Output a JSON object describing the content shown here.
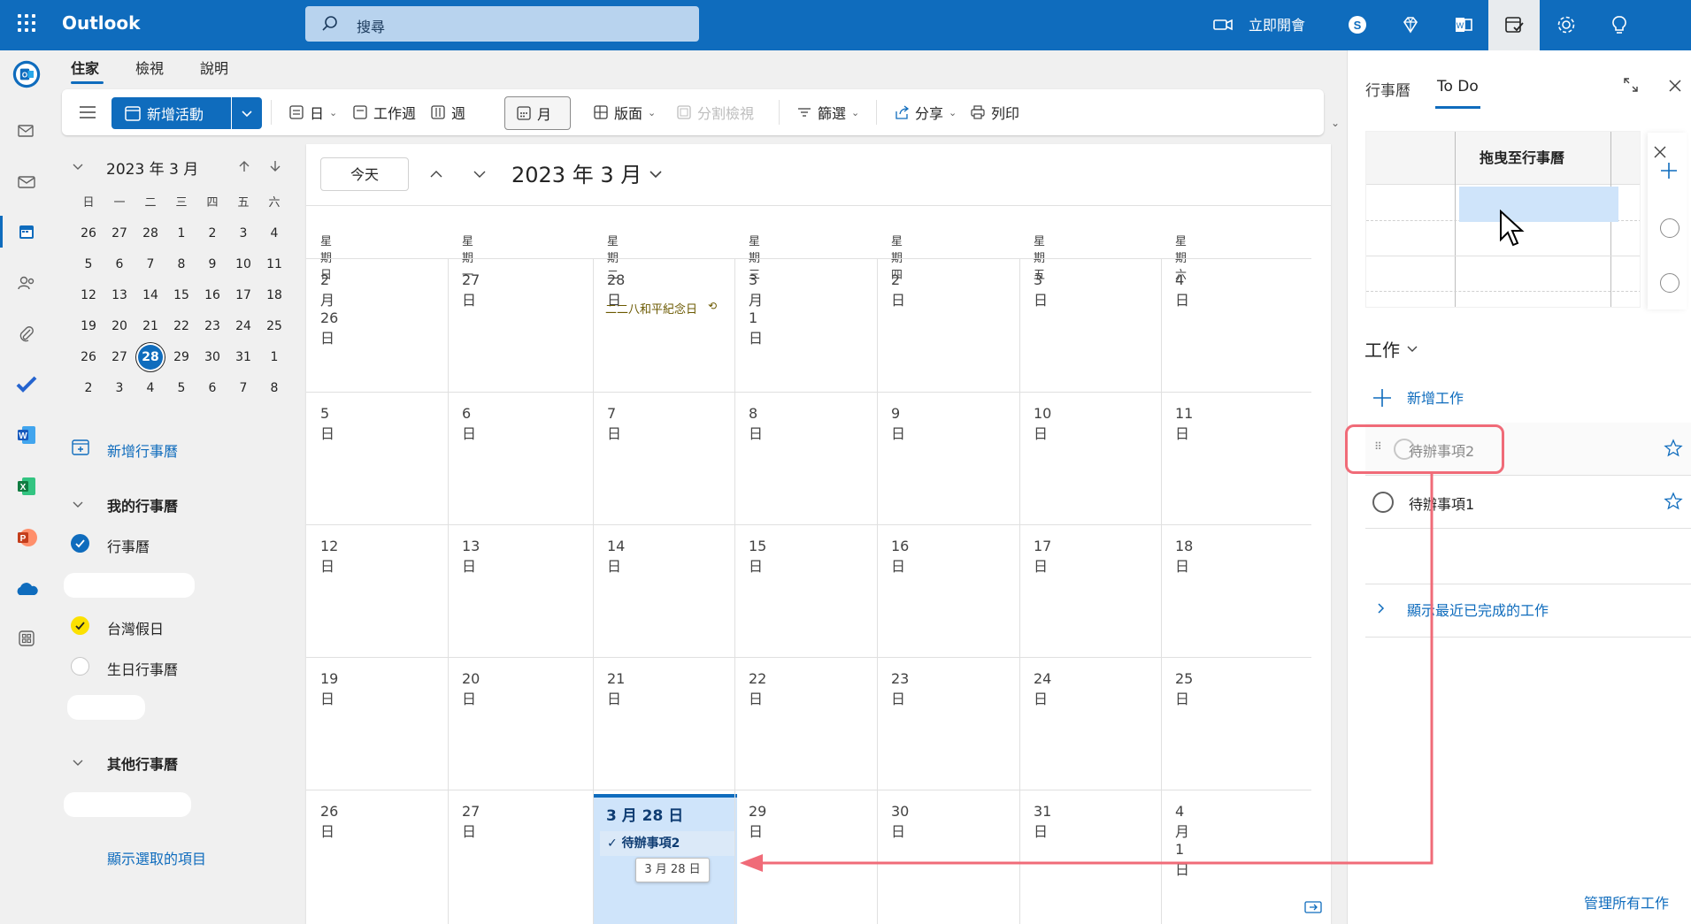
{
  "app": {
    "name": "Outlook"
  },
  "search": {
    "placeholder": "搜尋"
  },
  "topbar": {
    "meet_now": "立即開會"
  },
  "menu_tabs": [
    "住家",
    "檢視",
    "說明"
  ],
  "ribbon": {
    "new_event": "新增活動",
    "day": "日",
    "work_week": "工作週",
    "week": "週",
    "month": "月",
    "layout": "版面",
    "split_view": "分割檢視",
    "filter": "篩選",
    "share": "分享",
    "print": "列印"
  },
  "mini_calendar": {
    "title": "2023 年 3 月",
    "weekdays": [
      "日",
      "一",
      "二",
      "三",
      "四",
      "五",
      "六"
    ],
    "weeks": [
      [
        "26",
        "27",
        "28",
        "1",
        "2",
        "3",
        "4"
      ],
      [
        "5",
        "6",
        "7",
        "8",
        "9",
        "10",
        "11"
      ],
      [
        "12",
        "13",
        "14",
        "15",
        "16",
        "17",
        "18"
      ],
      [
        "19",
        "20",
        "21",
        "22",
        "23",
        "24",
        "25"
      ],
      [
        "26",
        "27",
        "28",
        "29",
        "30",
        "31",
        "1"
      ],
      [
        "2",
        "3",
        "4",
        "5",
        "6",
        "7",
        "8"
      ]
    ],
    "today": "28"
  },
  "left_panel": {
    "add_calendar": "新增行事曆",
    "my_calendars": "我的行事曆",
    "calendars": [
      {
        "name": "行事曆",
        "color": "#0f6cbd"
      },
      {
        "name": "台灣假日",
        "color": "#fce100"
      },
      {
        "name": "生日行事曆",
        "color": ""
      }
    ],
    "other_calendars": "其他行事曆",
    "show_selected": "顯示選取的項目"
  },
  "calendar": {
    "today_button": "今天",
    "title": "2023 年 3 月",
    "weekdays": [
      "星期日",
      "星期一",
      "星期二",
      "星期三",
      "星期四",
      "星期五",
      "星期六"
    ],
    "weeks": [
      [
        "2 月 26 日",
        "27 日",
        "28 日",
        "3 月 1 日",
        "2 日",
        "3 日",
        "4 日"
      ],
      [
        "5 日",
        "6 日",
        "7 日",
        "8 日",
        "9 日",
        "10 日",
        "11 日"
      ],
      [
        "12 日",
        "13 日",
        "14 日",
        "15 日",
        "16 日",
        "17 日",
        "18 日"
      ],
      [
        "19 日",
        "20 日",
        "21 日",
        "22 日",
        "23 日",
        "24 日",
        "25 日"
      ],
      [
        "26 日",
        "27 日",
        "3 月 28 日",
        "29 日",
        "30 日",
        "31 日",
        "4 月 1 日"
      ]
    ],
    "holiday_event": "二二八和平紀念日",
    "dropped_event": "待辦事項2",
    "drag_tooltip": "3 月 28 日"
  },
  "right_pane": {
    "tabs": [
      "行事曆",
      "To Do"
    ],
    "drag_hint": "拖曳至行事曆",
    "tasks_title": "工作",
    "add_task": "新增工作",
    "tasks": [
      {
        "title": "待辦事項2",
        "dragging": true
      },
      {
        "title": "待辦事項1",
        "dragging": false
      }
    ],
    "show_completed": "顯示最近已完成的工作",
    "manage_all": "管理所有工作"
  },
  "colors": {
    "accent": "#0f6cbd",
    "annotation": "#f06b78"
  }
}
